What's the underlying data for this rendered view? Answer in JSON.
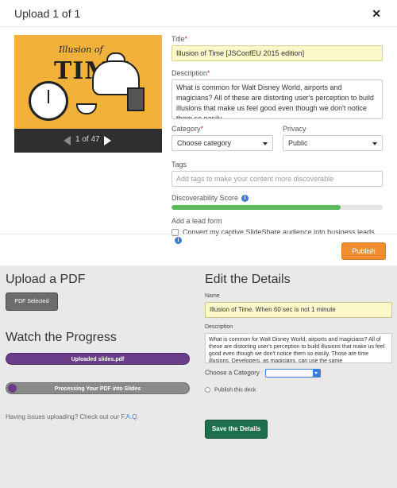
{
  "modal": {
    "title": "Upload 1 of 1",
    "close_icon": "close-icon",
    "player": {
      "slide_title_top": "Illusion of",
      "slide_title_main": "TIME",
      "page_counter": "1 of 47"
    },
    "form": {
      "title_label": "Title",
      "title_value": "Illusion of Time [JSConfEU 2015 edition]",
      "description_label": "Description",
      "description_value": "What is common for Walt Disney World, airports and magicians? All of these are distorting user's perception to build illusions that make us feel good even though we don't notice them so easily.",
      "category_label": "Category",
      "category_value": "Choose category",
      "privacy_label": "Privacy",
      "privacy_value": "Public",
      "tags_label": "Tags",
      "tags_placeholder": "Add tags to make your content more discoverable",
      "discoverability_label": "Discoverability Score",
      "discoverability_fraction": 0.8,
      "lead_form_label": "Add a lead form",
      "lead_form_checkbox_label": "Convert my captive SlideShare audience into business leads."
    },
    "publish_label": "Publish"
  },
  "lower": {
    "upload_heading": "Upload a PDF",
    "pdf_button_label": "PDF Selected",
    "progress_heading": "Watch the Progress",
    "uploaded_label": "Uploaded slides.pdf",
    "processing_label": "Processing Your PDF into Slides",
    "help_text": "Having issues uploading? Check out our ",
    "faq_label": "F.A.Q.",
    "details_heading": "Edit the Details",
    "name_label": "Name",
    "name_value": "Illusion of Time. When 60 sec is not 1 minute",
    "description_label": "Description",
    "description_value": "What is common for Walt Disney World, airports and magicians? All of these are distorting user's perception to build illusions that make us feel good even though we don't notice them so easily. Those are time illusions. Developers, as magicians, can use the same",
    "category_label": "Choose a Category",
    "publish_deck_label": "Publish this deck",
    "save_label": "Save the Details"
  },
  "colors": {
    "publish": "#ef8d2f",
    "save": "#1f6e4e",
    "uploaded_bar": "#6a3d8a",
    "discoverability": "#5cb85c"
  }
}
